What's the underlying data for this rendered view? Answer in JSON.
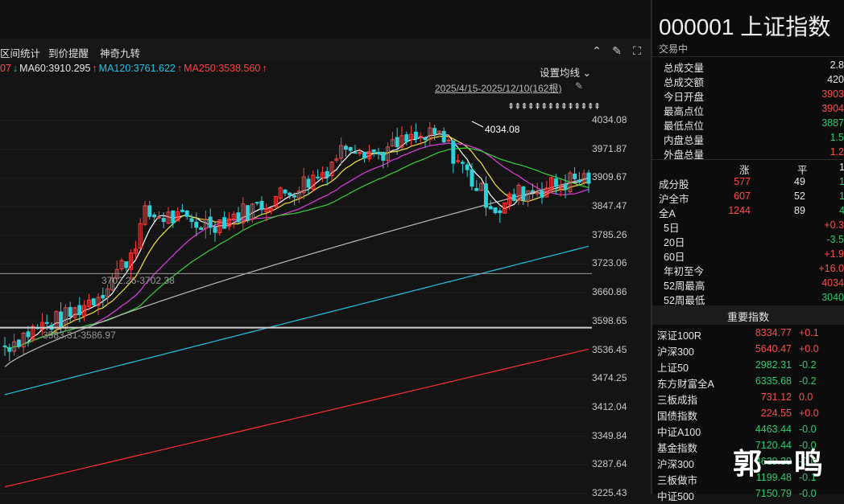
{
  "toolbar": {
    "items": [
      "区间统计",
      "到价提醒",
      "神奇九转"
    ],
    "settings_label": "设置均线 ⌄"
  },
  "ma_legend": [
    {
      "text": "07",
      "color": "#ff4d4d"
    },
    {
      "text": "↓",
      "color": "#2ecc71"
    },
    {
      "text": "MA60:3910.295",
      "color": "#e6e6e6"
    },
    {
      "text": "↑",
      "color": "#ff4d4d"
    },
    {
      "text": "MA120:3761.622",
      "color": "#22c3e6"
    },
    {
      "text": "↑",
      "color": "#ff4d4d"
    },
    {
      "text": "MA250:3538.560",
      "color": "#ff4040"
    },
    {
      "text": "↑",
      "color": "#ff4d4d"
    }
  ],
  "range_label": "2025/4/15-2025/12/10(162根)",
  "arrows_row": "⇞⇞⇞⇞⇞⇞⇞⇞⇞⇞⇞⇞⇞⇞",
  "chart_data": {
    "type": "candlestick",
    "y_ticks": [
      "4034.08",
      "3971.87",
      "3909.67",
      "3847.47",
      "3785.26",
      "3723.06",
      "3660.86",
      "3598.65",
      "3536.45",
      "3474.25",
      "3412.04",
      "3349.84",
      "3287.64",
      "3225.43"
    ],
    "ylim": [
      3225.43,
      4034.08
    ],
    "high_label": "4034.08",
    "range_lines": [
      {
        "label": "3702.26-3702.38",
        "value": 3702.3
      },
      {
        "label": "3583.31-3586.97",
        "value": 3585.1
      }
    ],
    "series": [
      {
        "name": "MA60",
        "value": 3910.295
      },
      {
        "name": "MA120",
        "value": 3761.622
      },
      {
        "name": "MA250",
        "value": 3538.56
      }
    ],
    "colors": {
      "up": "#ff4040",
      "down": "#2fd0d8",
      "ma5": "#ffffff",
      "ma10": "#f5e642",
      "ma20": "#e23ce6",
      "ma30": "#38d238",
      "ma60": "#bdbdbd",
      "ma120": "#22c3e6",
      "ma250": "#ff3030"
    }
  },
  "quote": {
    "title": "000001 上证指数",
    "status": "交易中",
    "stats": [
      {
        "label": "总成交量",
        "value": "2.8",
        "color": "#e6e6e6"
      },
      {
        "label": "总成交额",
        "value": "420",
        "color": "#e6e6e6"
      },
      {
        "label": "今日开盘",
        "value": "3903",
        "color": "#ff4d4d"
      },
      {
        "label": "最高点位",
        "value": "3904",
        "color": "#ff4d4d"
      },
      {
        "label": "最低点位",
        "value": "3887",
        "color": "#2ecc71"
      },
      {
        "label": "内盘总量",
        "value": "1.5",
        "color": "#2ecc71"
      },
      {
        "label": "外盘总量",
        "value": "1.2",
        "color": "#ff4d4d"
      }
    ],
    "breadth_header": {
      "up": "涨",
      "flat": "平",
      "down": "1"
    },
    "breadth": [
      {
        "label": "成分股",
        "up": "577",
        "flat": "49",
        "down": "1"
      },
      {
        "label": "沪全市",
        "up": "607",
        "flat": "52",
        "down": "1"
      },
      {
        "label": "全A",
        "up": "1244",
        "flat": "89",
        "down": "4"
      }
    ],
    "periods": [
      {
        "label": "5日",
        "value": "+0.3",
        "color": "#ff4d4d"
      },
      {
        "label": "20日",
        "value": "-3.5",
        "color": "#2ecc71"
      },
      {
        "label": "60日",
        "value": "+1.9",
        "color": "#ff4d4d"
      },
      {
        "label": "年初至今",
        "value": "+16.0",
        "color": "#ff4d4d"
      },
      {
        "label": "52周最高",
        "value": "4034",
        "color": "#ff4d4d"
      },
      {
        "label": "52周最低",
        "value": "3040",
        "color": "#2ecc71"
      }
    ],
    "indices_title": "重要指数",
    "indices": [
      {
        "name": "深证100R",
        "price": "8334.77",
        "chg": "+0.1",
        "color": "#ff4d4d"
      },
      {
        "name": "沪深300",
        "price": "5640.47",
        "chg": "+0.0",
        "color": "#ff4d4d"
      },
      {
        "name": "上证50",
        "price": "2982.31",
        "chg": "-0.2",
        "color": "#2ecc71"
      },
      {
        "name": "东方财富全A",
        "price": "6335.68",
        "chg": "-0.2",
        "color": "#2ecc71"
      },
      {
        "name": "三板成指",
        "price": "731.12",
        "chg": "0.0",
        "color": "#ff4d4d"
      },
      {
        "name": "国债指数",
        "price": "224.55",
        "chg": "+0.0",
        "color": "#ff4d4d"
      },
      {
        "name": "中证A100",
        "price": "4463.44",
        "chg": "-0.0",
        "color": "#2ecc71"
      },
      {
        "name": "基金指数",
        "price": "7120.44",
        "chg": "-0.0",
        "color": "#2ecc71"
      },
      {
        "name": "沪深300",
        "price": "4639.30",
        "chg": "-0.0",
        "color": "#2ecc71"
      },
      {
        "name": "三板做市",
        "price": "1199.48",
        "chg": "-0.1",
        "color": "#2ecc71"
      },
      {
        "name": "中证500",
        "price": "7150.79",
        "chg": "-0.0",
        "color": "#2ecc71"
      }
    ]
  },
  "watermark": "郭一鸣"
}
